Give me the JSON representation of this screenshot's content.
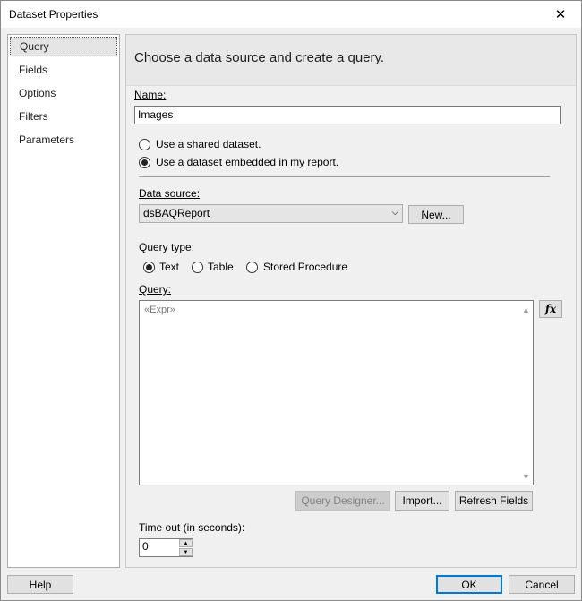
{
  "window": {
    "title": "Dataset Properties",
    "close_glyph": "✕"
  },
  "nav": {
    "items": [
      {
        "label": "Query",
        "selected": true
      },
      {
        "label": "Fields",
        "selected": false
      },
      {
        "label": "Options",
        "selected": false
      },
      {
        "label": "Filters",
        "selected": false
      },
      {
        "label": "Parameters",
        "selected": false
      }
    ]
  },
  "header": {
    "text": "Choose a data source and create a query."
  },
  "name": {
    "label": "Name:",
    "value": "Images"
  },
  "dataset_choice": {
    "options": [
      {
        "label": "Use a shared dataset.",
        "checked": false
      },
      {
        "label": "Use a dataset embedded in my report.",
        "checked": true
      }
    ]
  },
  "datasource": {
    "label": "Data source:",
    "value": "dsBAQReport",
    "new_button": "New..."
  },
  "query_type": {
    "label": "Query type:",
    "options": [
      {
        "label": "Text",
        "checked": true
      },
      {
        "label": "Table",
        "checked": false
      },
      {
        "label": "Stored Procedure",
        "checked": false
      }
    ]
  },
  "query": {
    "label": "Query:",
    "value": "«Expr»",
    "fx_label": "fx"
  },
  "query_buttons": {
    "designer": "Query Designer...",
    "import": "Import...",
    "refresh": "Refresh Fields"
  },
  "timeout": {
    "label": "Time out (in seconds):",
    "value": "0"
  },
  "footer": {
    "help": "Help",
    "ok": "OK",
    "cancel": "Cancel"
  },
  "colors": {
    "accent": "#0078d7"
  }
}
